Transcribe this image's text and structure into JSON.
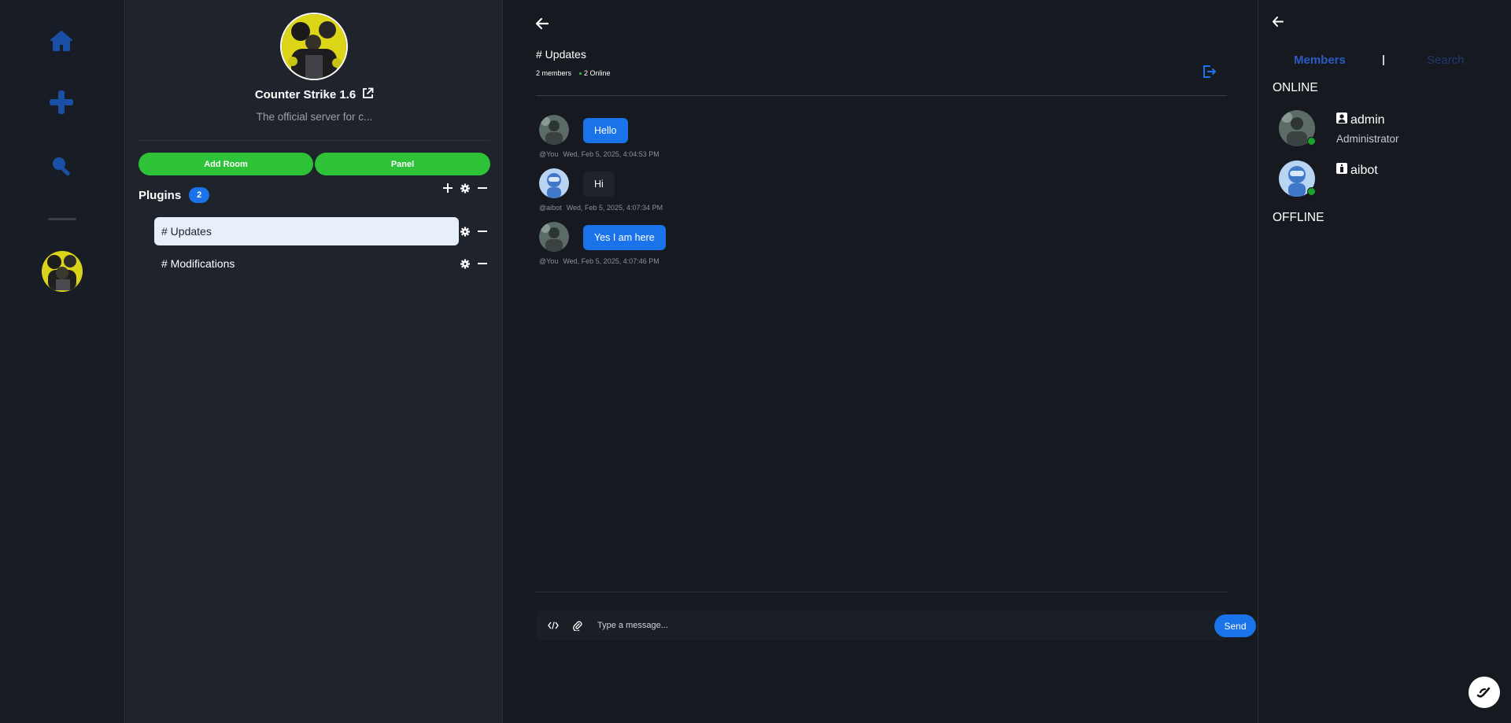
{
  "rail": {
    "icons": [
      "home-icon",
      "plus-icon",
      "search-icon",
      "server-avatar"
    ],
    "accent": "#1a4fa6"
  },
  "server": {
    "name": "Counter Strike 1.6",
    "description": "The official server for c...",
    "add_room_label": "Add Room",
    "panel_label": "Panel",
    "category": {
      "title": "Plugins",
      "count": "2"
    },
    "rooms": [
      {
        "label": "# Updates",
        "active": true
      },
      {
        "label": "# Modifications",
        "active": false
      }
    ]
  },
  "chat": {
    "title": "# Updates",
    "member_count": "2 members",
    "online_count": "2 Online",
    "messages": [
      {
        "author": "@You",
        "time": "Wed, Feb 5, 2025, 4:04:53 PM",
        "text": "Hello",
        "mine": true
      },
      {
        "author": "@aibot",
        "time": "Wed, Feb 5, 2025, 4:07:34 PM",
        "text": "Hi",
        "mine": false
      },
      {
        "author": "@You",
        "time": "Wed, Feb 5, 2025, 4:07:46 PM",
        "text": "Yes I am here",
        "mine": true
      }
    ],
    "composer": {
      "placeholder": "Type a message...",
      "send_label": "Send"
    }
  },
  "members": {
    "tab_members": "Members",
    "tab_search": "Search",
    "online_label": "ONLINE",
    "offline_label": "OFFLINE",
    "list": [
      {
        "name": "admin",
        "role": "Administrator",
        "icon": "user-icon"
      },
      {
        "name": "aibot",
        "role": "",
        "icon": "bot-icon"
      }
    ]
  },
  "colors": {
    "accent_blue": "#1a73e8",
    "green": "#2ec238",
    "online": "#1aa32b"
  }
}
